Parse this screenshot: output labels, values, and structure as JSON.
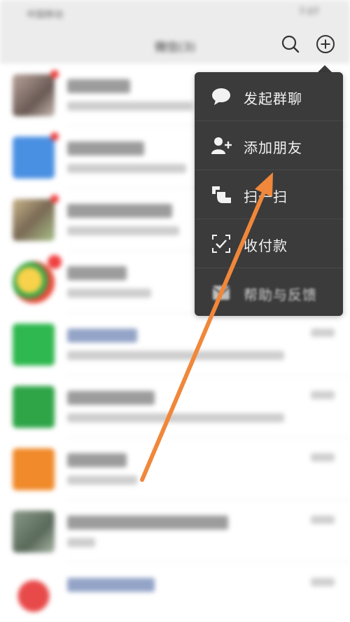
{
  "status_bar": {
    "carrier": "中国移动",
    "clock": "7:07"
  },
  "header": {
    "title": "微信(3)"
  },
  "menu": {
    "items": [
      {
        "label": "发起群聊",
        "icon": "chat-bubble-icon"
      },
      {
        "label": "添加朋友",
        "icon": "add-friend-icon"
      },
      {
        "label": "扫一扫",
        "icon": "scan-icon"
      },
      {
        "label": "收付款",
        "icon": "pay-receive-icon"
      },
      {
        "label": "帮助与反馈",
        "icon": "help-feedback-icon"
      }
    ]
  },
  "colors": {
    "menu_bg": "#3b3b3b",
    "header_bg": "#ececec",
    "arrow": "#f0873a",
    "badge": "#f04040"
  },
  "chat_list": [
    {
      "avatar": "#8a7f78",
      "badge": "dot"
    },
    {
      "avatar": "#4a90e2",
      "badge": "dot"
    },
    {
      "avatar": "#9a8a70",
      "badge": "dot"
    },
    {
      "avatar": "#e8b24a",
      "badge": "count"
    },
    {
      "avatar": "#2fb84f",
      "badge": "none"
    },
    {
      "avatar": "#2fa548",
      "badge": "none"
    },
    {
      "avatar": "#f08a2a",
      "badge": "none"
    },
    {
      "avatar": "#7a8a7a",
      "badge": "none"
    },
    {
      "avatar": "#e84a4a",
      "badge": "none"
    }
  ]
}
